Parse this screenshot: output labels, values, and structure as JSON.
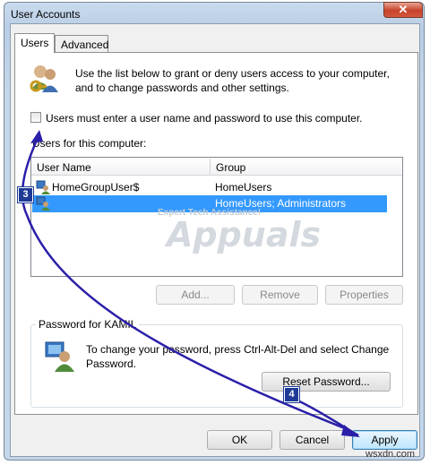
{
  "window": {
    "title": "User Accounts",
    "close_label": "✕"
  },
  "tabs": [
    {
      "label": "Users"
    },
    {
      "label": "Advanced"
    }
  ],
  "intro_text": [
    "Use the list below to grant or deny users access to your computer,",
    "and to change passwords and other settings."
  ],
  "checkbox_label": "Users must enter a user name and password to use this computer.",
  "users_list": {
    "title": "Users for this computer:",
    "columns": [
      "User Name",
      "Group"
    ],
    "rows": [
      {
        "name": "HomeGroupUser$",
        "group": "HomeUsers",
        "selected": false
      },
      {
        "name": "",
        "group": "HomeUsers; Administrators",
        "selected": true
      }
    ]
  },
  "list_buttons": {
    "add": "Add...",
    "remove": "Remove",
    "properties": "Properties"
  },
  "password_group": {
    "label": "Password for KAMIL",
    "text": [
      "To change your password, press Ctrl-Alt-Del and select Change",
      "Password."
    ],
    "reset_button": "Reset Password..."
  },
  "dialog_buttons": {
    "ok": "OK",
    "cancel": "Cancel",
    "apply": "Apply"
  },
  "annotations": {
    "step3": "3",
    "step4": "4"
  },
  "watermark": {
    "line1": "Expert Tech Assistance!",
    "brand": "Appuals"
  },
  "site_credit": "wsxdn.com",
  "colors": {
    "selection": "#3399ff",
    "arrow": "#2a1fa8",
    "badge": "#1e3a96"
  }
}
